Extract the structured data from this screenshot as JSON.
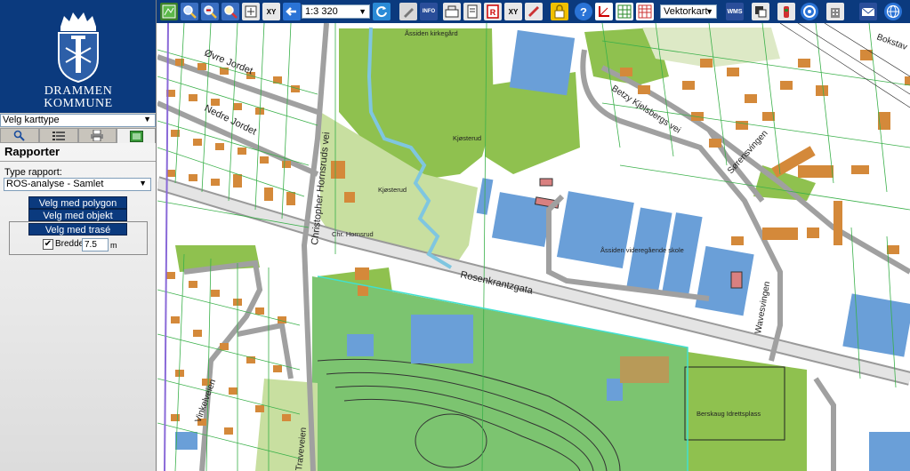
{
  "brand": {
    "org_line1": "DRAMMEN",
    "org_line2": "KOMMUNE"
  },
  "sidebar": {
    "map_type_select": "Velg karttype",
    "panel_title": "Rapporter",
    "report_type_label": "Type rapport:",
    "report_type_value": "ROS-analyse - Samlet",
    "btn_polygon": "Velg med polygon",
    "btn_object": "Velg med objekt",
    "btn_trase": "Velg med trasé",
    "width_label": "Bredde",
    "width_value": "7.5",
    "width_unit": "m",
    "width_checked": true,
    "check_mark": "✔"
  },
  "toolbar": {
    "scale_value": "1:3 320",
    "map_select_value": "Vektorkart",
    "icons": [
      "map-icon",
      "zoom-in-icon",
      "zoom-out-icon",
      "zoom-extent-icon",
      "pan-icon",
      "coordinate-icon",
      "back-icon",
      "scale-select",
      "refresh-icon",
      "pen-icon",
      "info-icon",
      "legend-icon",
      "print-icon",
      "report-icon",
      "coordinate-xy-icon",
      "measure-icon",
      "lock-icon",
      "help-icon",
      "axis-icon",
      "grid-icon",
      "table-icon",
      "map-select",
      "wms-icon",
      "export-icon",
      "fire-icon",
      "target-icon",
      "building-icon",
      "email-icon",
      "globe-icon"
    ],
    "labels": {
      "info": "INFO",
      "xy": "XY",
      "wms": "WMS"
    }
  },
  "map": {
    "labels": [
      "Øvre Jordet",
      "Nedre Jordet",
      "Christopher Hornsruds vei",
      "Åssiden kirkegård",
      "Kjøsterud",
      "Kjøsterud",
      "Chr. Hornsrud",
      "Rosenkrantzgata",
      "Åssiden videregående skole",
      "Betzy Kjelsbergs vei",
      "Sørensvingen",
      "Wavesvingen",
      "Vinkelveien",
      "Traveveien",
      "Berskaug Idrettsplass",
      "Bokstav"
    ]
  }
}
